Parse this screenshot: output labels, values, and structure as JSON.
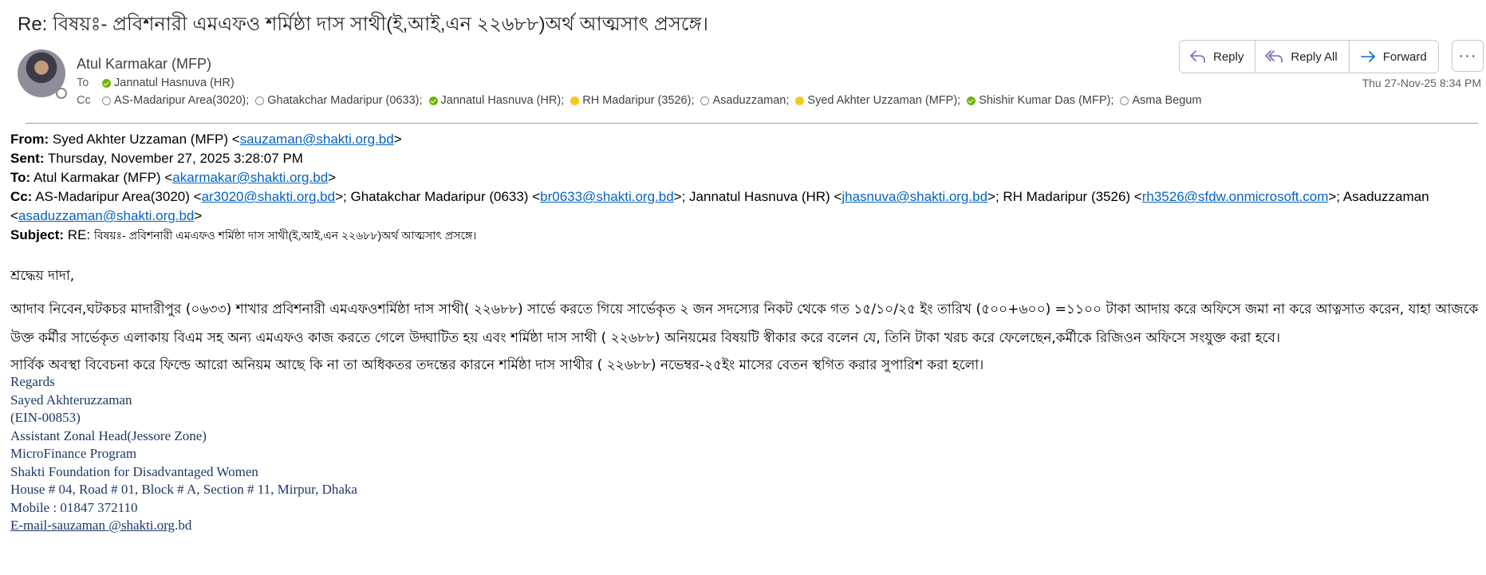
{
  "email": {
    "subject": "Re: বিষয়ঃ- প্রবিশনারী এমএফও শর্মিষ্ঠা দাস সাথী(ই,আই,এন ২২৬৮৮)অর্থ আত্মসাৎ প্রসঙ্গে।",
    "sender": "Atul  Karmakar (MFP)",
    "to_label": "To",
    "cc_label": "Cc",
    "to": [
      {
        "name": "Jannatul Hasnuva (HR)",
        "status": "available"
      }
    ],
    "cc": [
      {
        "name": "AS-Madaripur Area(3020);",
        "status": "offline"
      },
      {
        "name": "Ghatakchar Madaripur (0633);",
        "status": "offline"
      },
      {
        "name": "Jannatul Hasnuva (HR);",
        "status": "available"
      },
      {
        "name": "RH Madaripur (3526);",
        "status": "away"
      },
      {
        "name": "Asaduzzaman;",
        "status": "offline"
      },
      {
        "name": "Syed Akhter Uzzaman (MFP);",
        "status": "away"
      },
      {
        "name": "Shishir Kumar Das (MFP);",
        "status": "available"
      },
      {
        "name": "Asma Begum",
        "status": "offline"
      }
    ],
    "timestamp": "Thu 27-Nov-25 8:34 PM"
  },
  "actions": {
    "reply": "Reply",
    "reply_all": "Reply All",
    "forward": "Forward",
    "more": "···"
  },
  "quoted": {
    "from_label": "From:",
    "from_name": " Syed Akhter Uzzaman (MFP) <",
    "from_email": "sauzaman@shakti.org.bd",
    "sent_label": "Sent:",
    "sent_value": " Thursday, November 27, 2025 3:28:07 PM",
    "to_label": "To:",
    "to_name": " Atul  Karmakar (MFP) <",
    "to_email": "akarmakar@shakti.org.bd",
    "cc_label": "Cc:",
    "cc_1_name": " AS-Madaripur Area(3020) <",
    "cc_1_email": "ar3020@shakti.org.bd",
    "cc_2_name": ">; Ghatakchar Madaripur (0633) <",
    "cc_2_email": "br0633@shakti.org.bd",
    "cc_3_name": ">; Jannatul Hasnuva (HR) <",
    "cc_3_email": "jhasnuva@shakti.org.bd",
    "cc_4_name": ">; RH Madaripur (3526) <",
    "cc_4_email": "rh3526@sfdw.onmicrosoft.com",
    "cc_5_name": ">; Asaduzzaman <",
    "cc_5_email": "asaduzzaman@shakti.org.bd",
    "subject_label": "Subject:",
    "subject_prefix": " RE: ",
    "subject_value": "বিষয়ঃ- প্রবিশনারী এমএফও শর্মিষ্ঠা দাস সাথী(ই,আই,এন ২২৬৮৮)অর্থ আত্মসাৎ প্রসঙ্গে।"
  },
  "body": {
    "greeting": "শ্রদ্ধেয়  দাদা,",
    "paragraph1": "আদাব নিবেন,ঘটকচর মাদারীপুর (০৬৩৩) শাখার প্রবিশনারী এমএফওশর্মিষ্ঠা দাস সাথী( ২২৬৮৮)  সার্ভে করতে গিয়ে সার্ভেকৃত ২ জন সদস্যের নিকট থেকে গত ১৫/১০/২৫ ইং তারিখ (৫০০+৬০০) =১১০০ টাকা আদায় করে অফিসে জমা না করে আত্নসাত করেন, যাহা আজকে উক্ত কর্মীর সার্ভেকৃত এলাকায় বিএম সহ অন্য এমএফও কাজ করতে গেলে  উদ্ঘাটিত হয় এবং শর্মিষ্ঠা দাস সাথী ( ২২৬৮৮) অনিয়মের বিষয়টি স্বীকার করে বলেন যে, তিনি টাকা খরচ করে ফেলেছেন,কর্মীকে রিজিওন অফিসে সংযুক্ত করা হবে।",
    "paragraph2": "সার্বিক অবস্থা বিবেচনা করে ফিল্ডে আরো অনিয়ম আছে কি না তা অধিকতর তদন্তের কারনে শর্মিষ্ঠা দাস সাথীর ( ২২৬৮৮) নভেম্বর-২৫ইং মাসের বেতন স্থগিত করার সুপারিশ করা হলো।"
  },
  "signature": {
    "line1": "Regards",
    "line2": "Sayed Akhteruzzaman",
    "line3": "(EIN-00853)",
    "line4": "Assistant Zonal Head(Jessore Zone)",
    "line5": "MicroFinance Program",
    "line6": "Shakti Foundation for Disadvantaged Women",
    "line7": "House # 04, Road # 01, Block # A, Section # 11, Mirpur, Dhaka",
    "line8": "Mobile : 01847 372110",
    "email_link": "E-mail-sauzaman @shakti.org",
    "email_suffix": ".bd"
  },
  "colors": {
    "link": "#0563c1",
    "signature": "#1f3864",
    "available": "#6bb700",
    "away": "#f8c61c",
    "accent": "#0f6cbd",
    "reply_all_icon": "#8764b8"
  },
  "icons": {
    "reply": "reply-icon",
    "reply_all": "reply-all-icon",
    "forward": "forward-icon",
    "more": "more-icon"
  }
}
